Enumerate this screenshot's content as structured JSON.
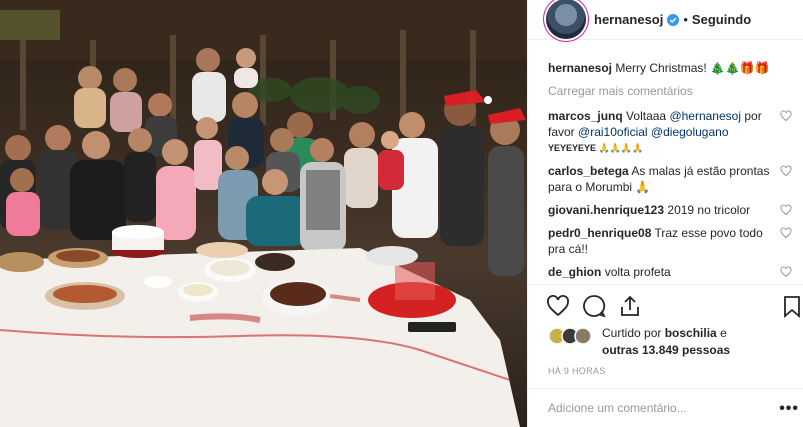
{
  "post": {
    "username": "hernanesoj",
    "follow_dot": "•",
    "follow_label": "Seguindo",
    "caption_user": "hernanesoj",
    "caption_text": "Merry Christmas! 🎄🎄🎁🎁",
    "load_more": "Carregar mais comentários",
    "comments": [
      {
        "user": "marcos_junq",
        "text": "Voltaaa",
        "tag1": "@hernanesoj",
        "text2": "por favor",
        "tag2": "@rai10oficial",
        "tag3": "@diegolugano",
        "extra": "YEYEYEYE 🙏🙏🙏🙏"
      },
      {
        "user": "carlos_betega",
        "text": "As malas já estão prontas para o Morumbi 🙏"
      },
      {
        "user": "giovani.henrique123",
        "text": "2019 no tricolor"
      },
      {
        "user": "pedr0_henrique08",
        "text": "Traz esse povo todo pra cá!!"
      },
      {
        "user": "de_ghion",
        "text": "volta profeta"
      }
    ],
    "liked_by_prefix": "Curtido por",
    "liked_by_user": "boschilia",
    "liked_by_and": "e",
    "liked_by_others": "outras 13.849 pessoas",
    "time_ago": "HÁ 9 HORAS",
    "add_comment_placeholder": "Adicione um comentário...",
    "more_dots": "•••"
  },
  "colors": {
    "verified": "#3897f0",
    "link": "#003569",
    "muted": "#999999"
  },
  "icons": [
    "verified-icon",
    "heart-icon",
    "comment-icon",
    "share-icon",
    "bookmark-icon"
  ]
}
